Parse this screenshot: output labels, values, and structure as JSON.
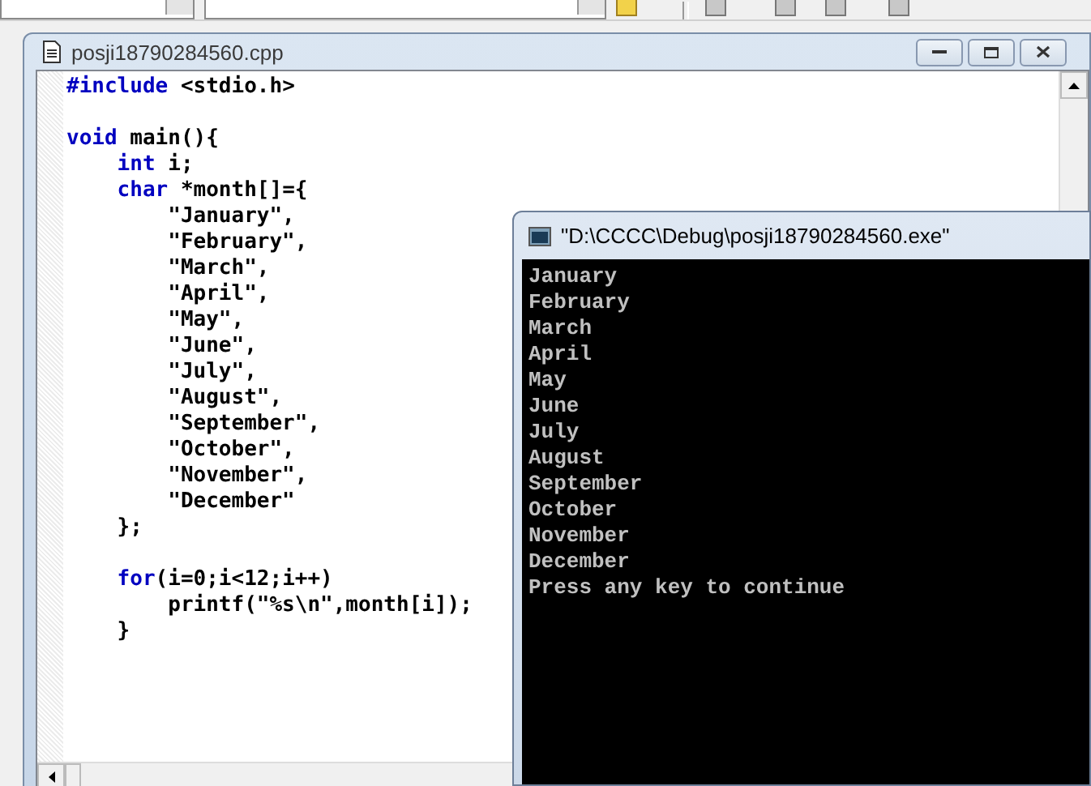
{
  "editor": {
    "title": "posji18790284560.cpp",
    "lines": [
      [
        {
          "kind": "keyword",
          "text": "#include"
        },
        {
          "kind": "plain",
          "text": " <stdio.h>"
        }
      ],
      [
        {
          "kind": "blank"
        }
      ],
      [
        {
          "kind": "keyword",
          "text": "void"
        },
        {
          "kind": "plain",
          "text": " main(){"
        }
      ],
      [
        {
          "kind": "keyword",
          "text": "    int"
        },
        {
          "kind": "plain",
          "text": " i;"
        }
      ],
      [
        {
          "kind": "keyword",
          "text": "    char"
        },
        {
          "kind": "plain",
          "text": " *month[]={"
        }
      ],
      [
        {
          "kind": "plain",
          "text": "        \"January\","
        }
      ],
      [
        {
          "kind": "plain",
          "text": "        \"February\","
        }
      ],
      [
        {
          "kind": "plain",
          "text": "        \"March\","
        }
      ],
      [
        {
          "kind": "plain",
          "text": "        \"April\","
        }
      ],
      [
        {
          "kind": "plain",
          "text": "        \"May\","
        }
      ],
      [
        {
          "kind": "plain",
          "text": "        \"June\","
        }
      ],
      [
        {
          "kind": "plain",
          "text": "        \"July\","
        }
      ],
      [
        {
          "kind": "plain",
          "text": "        \"August\","
        }
      ],
      [
        {
          "kind": "plain",
          "text": "        \"September\","
        }
      ],
      [
        {
          "kind": "plain",
          "text": "        \"October\","
        }
      ],
      [
        {
          "kind": "plain",
          "text": "        \"November\","
        }
      ],
      [
        {
          "kind": "plain",
          "text": "        \"December\""
        }
      ],
      [
        {
          "kind": "plain",
          "text": "    };"
        }
      ],
      [
        {
          "kind": "blank"
        }
      ],
      [
        {
          "kind": "keyword",
          "text": "    for"
        },
        {
          "kind": "plain",
          "text": "(i=0;i<12;i++)"
        }
      ],
      [
        {
          "kind": "plain",
          "text": "        printf(\"%s\\n\",month[i]);"
        }
      ],
      [
        {
          "kind": "plain",
          "text": "    }"
        }
      ]
    ]
  },
  "console": {
    "title": "\"D:\\CCCC\\Debug\\posji18790284560.exe\"",
    "lines": [
      "January",
      "February",
      "March",
      "April",
      "May",
      "June",
      "July",
      "August",
      "September",
      "October",
      "November",
      "December",
      "Press any key to continue"
    ]
  }
}
